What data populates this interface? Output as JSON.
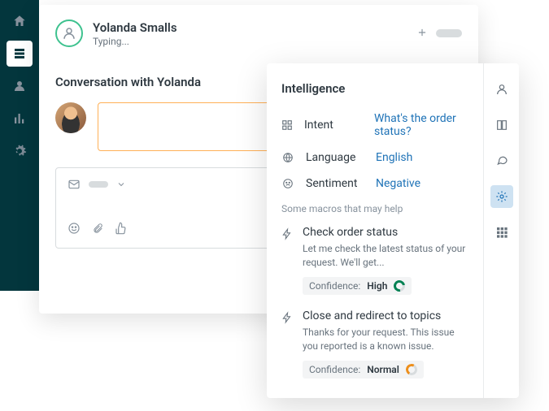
{
  "header": {
    "user_name": "Yolanda Smalls",
    "status": "Typing..."
  },
  "conversation": {
    "title": "Conversation with Yolanda"
  },
  "intelligence": {
    "title": "Intelligence",
    "intent_label": "Intent",
    "intent_value": "What's the order status?",
    "language_label": "Language",
    "language_value": "English",
    "sentiment_label": "Sentiment",
    "sentiment_value": "Negative",
    "macros_hint": "Some macros that may help",
    "macros": [
      {
        "title": "Check order status",
        "desc": "Let me check the latest status of your request. We'll get...",
        "confidence_label": "Confidence:",
        "confidence_value": "High"
      },
      {
        "title": "Close and redirect to topics",
        "desc": "Thanks for your request. This issue you reported is a known issue.",
        "confidence_label": "Confidence:",
        "confidence_value": "Normal"
      }
    ]
  }
}
